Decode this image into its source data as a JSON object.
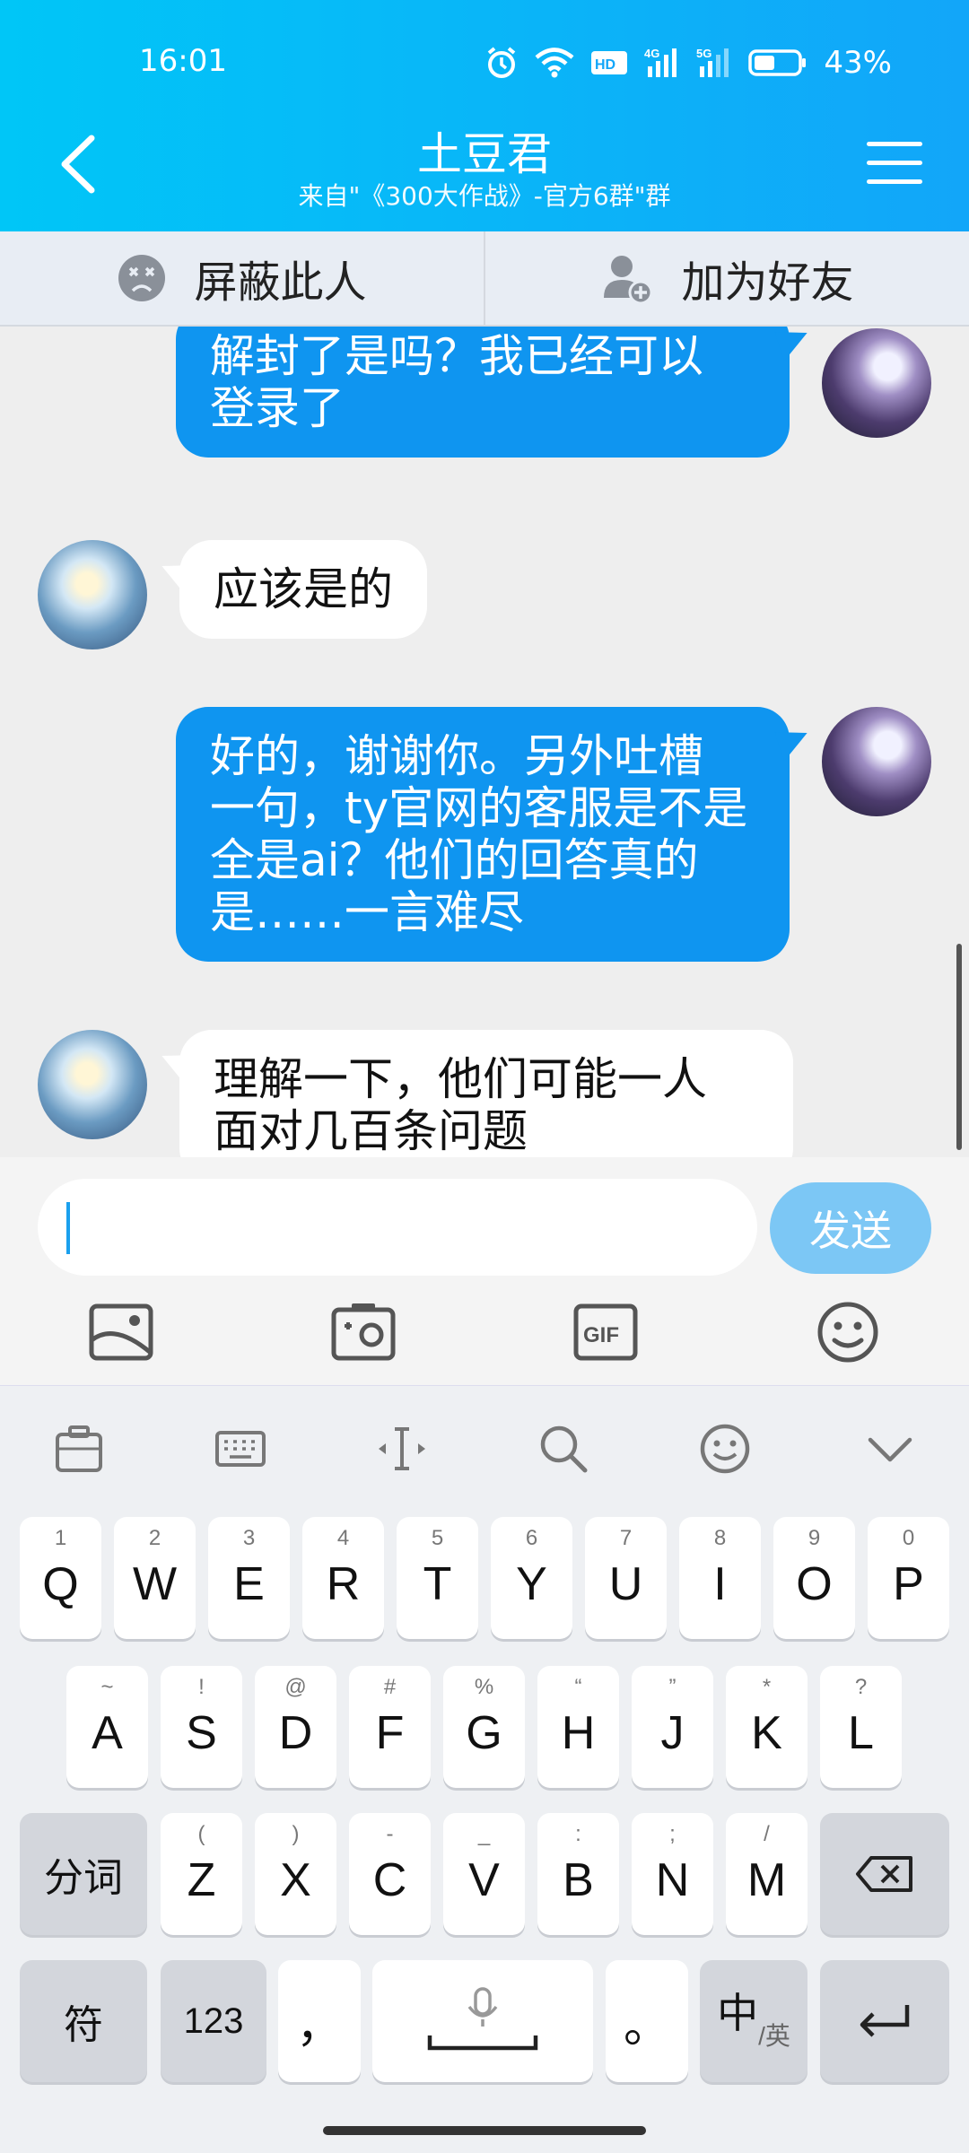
{
  "status_bar": {
    "time": "16:01",
    "battery": "43%",
    "icons": [
      "alarm-icon",
      "wifi-icon",
      "hd-icon",
      "4g-signal-icon",
      "5g-signal-icon",
      "battery-icon"
    ],
    "hd_label": "HD",
    "g4_label": "4G",
    "g5_label": "5G"
  },
  "header": {
    "title": "土豆君",
    "subtitle": "来自\"《300大作战》-官方6群\"群",
    "back_icon": "chevron-left-icon",
    "menu_icon": "hamburger-menu-icon"
  },
  "actions": {
    "block_label": "屏蔽此人",
    "add_friend_label": "加为好友"
  },
  "messages": [
    {
      "from": "self",
      "text_lines": [
        "解封了是吗？我已经可以",
        "登录了"
      ]
    },
    {
      "from": "other",
      "text_lines": [
        "应该是的"
      ]
    },
    {
      "from": "self",
      "text_lines": [
        "好的，谢谢你。另外吐槽",
        "一句，ty官网的客服是不是",
        "全是ai？他们的回答真的",
        "是……一言难尽"
      ]
    },
    {
      "from": "other",
      "text_lines": [
        "理解一下，他们可能一人",
        "面对几百条问题"
      ]
    }
  ],
  "input": {
    "value": "",
    "send_label": "发送",
    "tools": [
      "image-icon",
      "camera-icon",
      "gif-icon",
      "emoji-icon"
    ],
    "gif_label": "GIF"
  },
  "keyboard": {
    "toolbar": [
      "clipboard-icon",
      "keyboard-icon",
      "cursor-icon",
      "search-icon",
      "emoji-icon",
      "collapse-icon"
    ],
    "row1": [
      {
        "hint": "1",
        "key": "Q"
      },
      {
        "hint": "2",
        "key": "W"
      },
      {
        "hint": "3",
        "key": "E"
      },
      {
        "hint": "4",
        "key": "R"
      },
      {
        "hint": "5",
        "key": "T"
      },
      {
        "hint": "6",
        "key": "Y"
      },
      {
        "hint": "7",
        "key": "U"
      },
      {
        "hint": "8",
        "key": "I"
      },
      {
        "hint": "9",
        "key": "O"
      },
      {
        "hint": "0",
        "key": "P"
      }
    ],
    "row2": [
      {
        "hint": "~",
        "key": "A"
      },
      {
        "hint": "!",
        "key": "S"
      },
      {
        "hint": "@",
        "key": "D"
      },
      {
        "hint": "#",
        "key": "F"
      },
      {
        "hint": "%",
        "key": "G"
      },
      {
        "hint": "“",
        "key": "H"
      },
      {
        "hint": "”",
        "key": "J"
      },
      {
        "hint": "*",
        "key": "K"
      },
      {
        "hint": "?",
        "key": "L"
      }
    ],
    "row3": [
      {
        "hint": "(",
        "key": "Z"
      },
      {
        "hint": ")",
        "key": "X"
      },
      {
        "hint": "-",
        "key": "C"
      },
      {
        "hint": "_",
        "key": "V"
      },
      {
        "hint": ":",
        "key": "B"
      },
      {
        "hint": ";",
        "key": "N"
      },
      {
        "hint": "/",
        "key": "M"
      }
    ],
    "segment_label": "分词",
    "symbols_label": "符",
    "numbers_label": "123",
    "comma_label": "，",
    "period_label": "。",
    "lang_main": "中",
    "lang_sub": "/英"
  }
}
